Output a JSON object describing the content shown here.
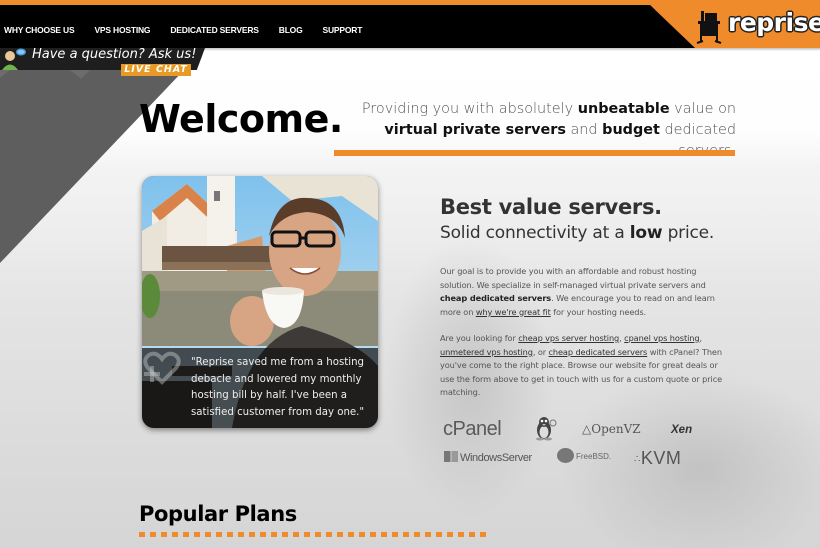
{
  "nav": {
    "items": [
      {
        "label": "WHY CHOOSE US"
      },
      {
        "label": "VPS HOSTING"
      },
      {
        "label": "DEDICATED SERVERS"
      },
      {
        "label": "BLOG"
      },
      {
        "label": "SUPPORT"
      }
    ],
    "logo_text": "reprise",
    "accent_color": "#f08b2c"
  },
  "chat": {
    "question": "Have a question? Ask us!",
    "live_chat_label": "LIVE CHAT"
  },
  "hero": {
    "welcome": "Welcome.",
    "tagline": {
      "t1": "Providing you with absolutely ",
      "b1": "unbeatable",
      "t2": " value on ",
      "b2": "virtual private servers",
      "t3": " and ",
      "b3": "budget",
      "t4": " dedicated servers."
    }
  },
  "testimonial": {
    "quote": "\"Reprise saved me from a hosting debacle and lowered my monthly hosting bill by half. I've been a satisfied customer from day one.\""
  },
  "intro": {
    "headline": "Best value servers.",
    "subhead_pre": "Solid connectivity at a ",
    "subhead_bold": "low",
    "subhead_post": " price.",
    "para1": {
      "t1": "Our goal is to provide you with an affordable and robust hosting solution. We specialize in self-managed virtual private servers and ",
      "b1": "cheap dedicated servers",
      "t2": ". We encourage you to read on and learn more on ",
      "link1": "why we're great fit",
      "t3": " for your hosting needs."
    },
    "para2": {
      "t1": "Are you looking for ",
      "link1": "cheap vps server hosting",
      "t2": ", ",
      "link2": "cpanel vps hosting",
      "t3": ", ",
      "link3": "unmetered vps hosting",
      "t4": ", or ",
      "link4": "cheap dedicated servers",
      "t5": " with cPanel? Then you've come to the right place. Browse our website for great deals or use the form above to get in touch with us for a custom quote or price matching."
    }
  },
  "tech_logos": {
    "cpanel": "cPanel",
    "linux": "linux-tux-icon",
    "openvz": "OpenVZ",
    "xen": "Xen",
    "windows": "WindowsServer",
    "freebsd": "FreeBSD.",
    "kvm": "KVM"
  },
  "plans": {
    "title": "Popular Plans"
  }
}
